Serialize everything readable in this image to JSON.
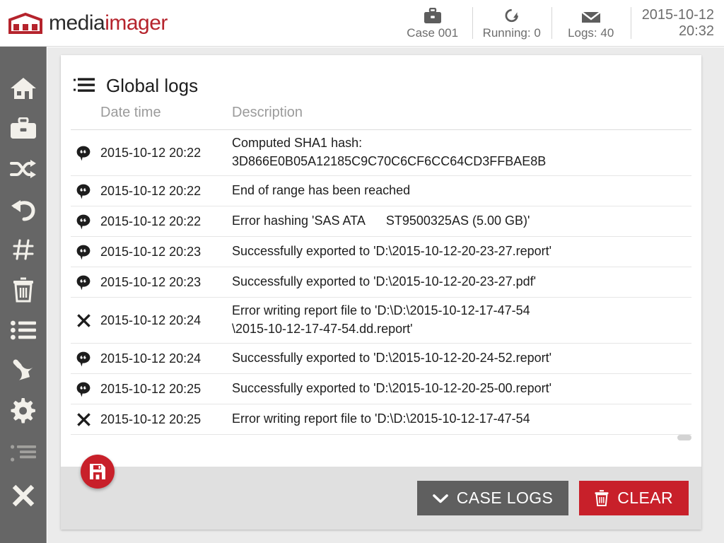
{
  "brand": {
    "name_part1": "media",
    "name_part2": "imager",
    "logo_icon": "mediaimager-logo-icon",
    "accent_color": "#b5232c"
  },
  "header": {
    "status": [
      {
        "icon": "briefcase-icon",
        "label": "Case 001"
      },
      {
        "icon": "refresh-icon",
        "label": "Running: 0"
      },
      {
        "icon": "envelope-icon",
        "label": "Logs: 40"
      }
    ],
    "datetime": {
      "date": "2015-10-12",
      "time": "20:32"
    }
  },
  "sidebar": {
    "items": [
      {
        "icon": "home-icon",
        "name": "home",
        "disabled": false
      },
      {
        "icon": "briefcase-icon",
        "name": "case",
        "disabled": false
      },
      {
        "icon": "shuffle-icon",
        "name": "clone",
        "disabled": false
      },
      {
        "icon": "undo-icon",
        "name": "restore",
        "disabled": false
      },
      {
        "icon": "hash-icon",
        "name": "hash",
        "disabled": false
      },
      {
        "icon": "trash-icon",
        "name": "wipe",
        "disabled": false
      },
      {
        "icon": "list-icon",
        "name": "logs",
        "disabled": false
      },
      {
        "icon": "wrench-icon",
        "name": "tools",
        "disabled": false
      },
      {
        "icon": "gear-icon",
        "name": "settings",
        "disabled": false
      },
      {
        "icon": "indent-list-icon",
        "name": "details",
        "disabled": true
      },
      {
        "icon": "close-icon",
        "name": "exit",
        "disabled": false
      }
    ]
  },
  "card": {
    "icon": "logs-list-icon",
    "title": "Global logs",
    "columns": {
      "icon": "",
      "datetime": "Date time",
      "description": "Description"
    },
    "rows": [
      {
        "icon": "comment-icon",
        "datetime": "2015-10-12 20:22",
        "description": "Computed SHA1 hash:\n3D866E0B05A12185C9C70C6CF6CC64CD3FFBAE8B",
        "tall": true
      },
      {
        "icon": "comment-icon",
        "datetime": "2015-10-12 20:22",
        "description": "End of range has been reached",
        "tall": false
      },
      {
        "icon": "comment-icon",
        "datetime": "2015-10-12 20:22",
        "description": "Error hashing 'SAS ATA      ST9500325AS (5.00 GB)'",
        "tall": false
      },
      {
        "icon": "comment-icon",
        "datetime": "2015-10-12 20:23",
        "description": "Successfully exported to 'D:\\2015-10-12-20-23-27.report'",
        "tall": false
      },
      {
        "icon": "comment-icon",
        "datetime": "2015-10-12 20:23",
        "description": "Successfully exported to 'D:\\2015-10-12-20-23-27.pdf'",
        "tall": false
      },
      {
        "icon": "error-x-icon",
        "datetime": "2015-10-12 20:24",
        "description": "Error writing report file to 'D:\\D:\\2015-10-12-17-47-54\n\\2015-10-12-17-47-54.dd.report'",
        "tall": true
      },
      {
        "icon": "comment-icon",
        "datetime": "2015-10-12 20:24",
        "description": "Successfully exported to 'D:\\2015-10-12-20-24-52.report'",
        "tall": false
      },
      {
        "icon": "comment-icon",
        "datetime": "2015-10-12 20:25",
        "description": "Successfully exported to 'D:\\2015-10-12-20-25-00.report'",
        "tall": false
      },
      {
        "icon": "error-x-icon",
        "datetime": "2015-10-12 20:25",
        "description": "Error writing report file to 'D:\\D:\\2015-10-12-17-47-54",
        "tall": false
      }
    ]
  },
  "footer": {
    "save_button": {
      "icon": "save-icon",
      "label": ""
    },
    "case_logs_button": {
      "icon": "chevron-down-icon",
      "label": "CASE LOGS"
    },
    "clear_button": {
      "icon": "trash-icon",
      "label": "CLEAR",
      "color": "#c8202a"
    }
  }
}
